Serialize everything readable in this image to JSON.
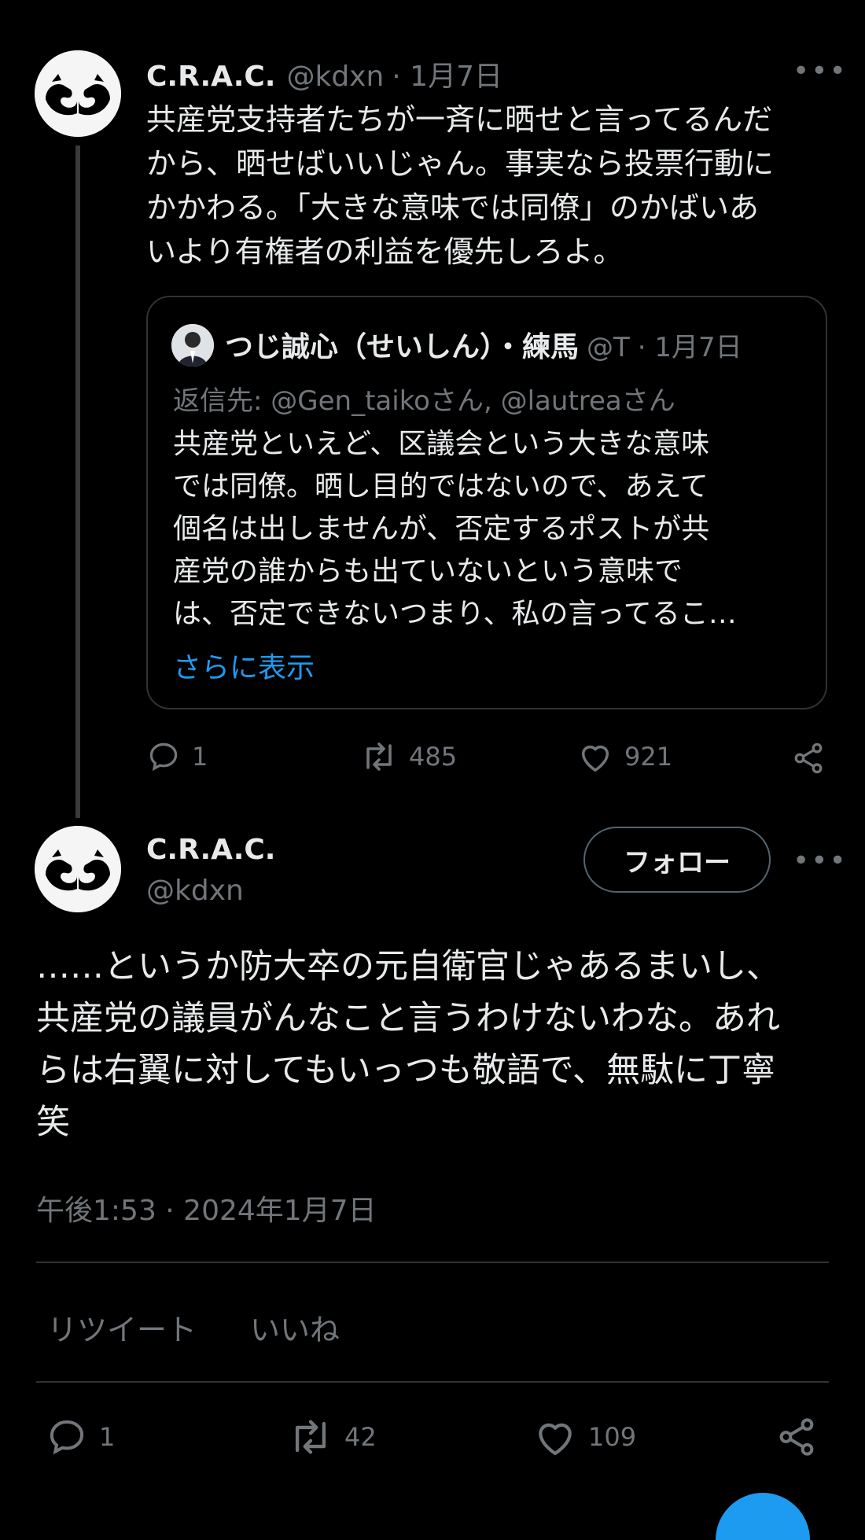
{
  "first_tweet": {
    "author_name": "C.R.A.C.",
    "author_handle": "@kdxn",
    "date": "· 1月7日",
    "text": "共産党支持者たちが一斉に晒せと言ってるんだ\nから、晒せばいいじゃん。事実なら投票行動に\nかかわる。「大きな意味では同僚」のかばいあ\nいより有権者の利益を優先しろよ。",
    "more_icon": "more-horizontal-icon",
    "quote": {
      "author_name": "つじ誠心（せいしん）・練馬",
      "author_handle": "@T",
      "date": "· 1月7日",
      "reply_prefix": "返信先: ",
      "reply_user1": "@Gen_taiko",
      "reply_san1": "さん, ",
      "reply_user2": "@lautrea",
      "reply_san2": "さん",
      "text": "共産党といえど、区議会という大きな意味\nでは同僚。晒し目的ではないので、あえて\n個名は出しませんが、否定するポストが共\n産党の誰からも出ていないという意味で\nは、否定できないつまり、私の言ってるこ…",
      "show_more": "さらに表示"
    },
    "actions": {
      "replies": "1",
      "retweets": "485",
      "likes": "921"
    }
  },
  "main_tweet": {
    "author_name": "C.R.A.C.",
    "author_handle": "@kdxn",
    "follow_label": "フォロー",
    "text": "……というか防大卒の元自衛官じゃあるまいし、\n共産党の議員がんなこと言うわけないわな。あれ\nらは右翼に対してもいっつも敬語で、無駄に丁寧\n笑",
    "timestamp": "午後1:53 · 2024年1月7日",
    "tabs": [
      "リツイート",
      "いいね"
    ],
    "actions": {
      "replies": "1",
      "retweets": "42",
      "likes": "109"
    }
  },
  "colors": {
    "background": "#000000",
    "text": "#e7e9ea",
    "muted": "#71767b",
    "link": "#1d9bf0",
    "border": "#2f3336"
  }
}
